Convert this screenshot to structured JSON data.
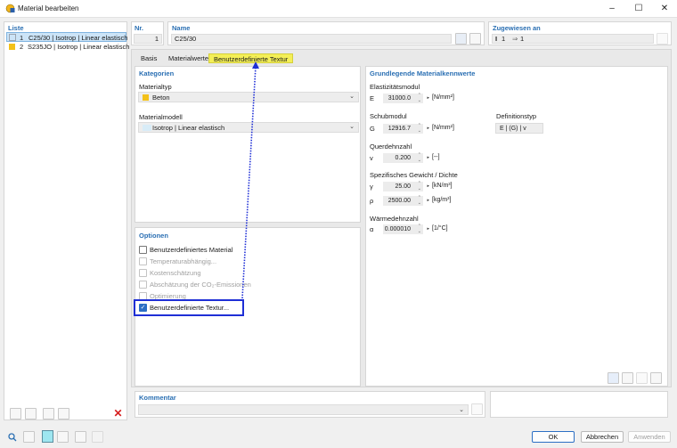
{
  "window": {
    "title": "Material bearbeiten",
    "minimize": "–",
    "maximize": "☐",
    "close": "✕"
  },
  "liste": {
    "header": "Liste",
    "items": [
      {
        "num": "1",
        "label": "C25/30 | Isotrop | Linear elastisch",
        "color": "#dfe4ea"
      },
      {
        "num": "2",
        "label": "S235JO | Isotrop | Linear elastisch",
        "color": "#f3c11a"
      }
    ]
  },
  "nr": {
    "header": "Nr.",
    "value": "1"
  },
  "name": {
    "header": "Name",
    "value": "C25/30"
  },
  "zugewiesen": {
    "header": "Zugewiesen an",
    "value1": "1",
    "value2": "1"
  },
  "tabs": [
    {
      "label": "Basis"
    },
    {
      "label": "Materialwerte"
    },
    {
      "label": "Benutzerdefinierte Textur"
    }
  ],
  "kategorien": {
    "header": "Kategorien",
    "materialtyp_label": "Materialtyp",
    "materialtyp_value": "Beton",
    "materialtyp_color": "#f3c11a",
    "materialmodell_label": "Materialmodell",
    "materialmodell_value": "Isotrop | Linear elastisch",
    "materialmodell_color": "#d8ecf7"
  },
  "kennwerte": {
    "header": "Grundlegende Materialkennwerte",
    "elastizitaet_label": "Elastizitätsmodul",
    "E_sym": "E",
    "E_value": "31000.0",
    "E_unit": "[N/mm²]",
    "schub_label": "Schubmodul",
    "G_sym": "G",
    "G_value": "12916.7",
    "G_unit": "[N/mm²]",
    "definitionstyp_label": "Definitionstyp",
    "definitionstyp_value": "E | (G) | v",
    "quer_label": "Querdehnzahl",
    "v_sym": "v",
    "v_value": "0.200",
    "v_unit": "[--]",
    "gewicht_label": "Spezifisches Gewicht / Dichte",
    "gamma_sym": "γ",
    "gamma_value": "25.00",
    "gamma_unit": "[kN/m³]",
    "rho_sym": "ρ",
    "rho_value": "2500.00",
    "rho_unit": "[kg/m³]",
    "waerme_label": "Wärmedehnzahl",
    "alpha_sym": "α",
    "alpha_value": "0.000010",
    "alpha_unit": "[1/°C]"
  },
  "optionen": {
    "header": "Optionen",
    "items": [
      {
        "label": "Benutzerdefiniertes Material",
        "checked": false,
        "disabled": false
      },
      {
        "label": "Temperaturabhängig...",
        "checked": false,
        "disabled": true
      },
      {
        "label": "Kostenschätzung",
        "checked": false,
        "disabled": true
      },
      {
        "label": "Abschätzung der CO₂-Emissionen",
        "checked": false,
        "disabled": true
      },
      {
        "label": "Optimierung",
        "checked": false,
        "disabled": true
      },
      {
        "label": "Benutzerdefinierte Textur...",
        "checked": true,
        "disabled": false
      }
    ]
  },
  "kommentar": {
    "header": "Kommentar",
    "value": ""
  },
  "buttons": {
    "ok": "OK",
    "abbrechen": "Abbrechen",
    "anwenden": "Anwenden"
  },
  "colors": {
    "accent": "#2a6fb3",
    "highlight": "#1f2fd6",
    "tab_active": "#f4ef57"
  }
}
